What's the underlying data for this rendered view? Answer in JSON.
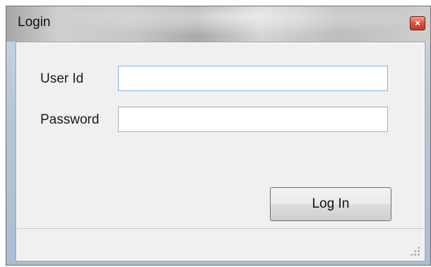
{
  "window": {
    "title": "Login",
    "close_glyph": "×"
  },
  "form": {
    "user_id_label": "User Id",
    "user_id_value": "",
    "password_label": "Password",
    "password_value": "",
    "login_button_label": "Log In"
  },
  "icons": {
    "close": "close-icon",
    "resize_grip": "resize-grip-icon"
  },
  "colors": {
    "close_button": "#d9533d",
    "focused_input_border": "#7eb4ea"
  }
}
